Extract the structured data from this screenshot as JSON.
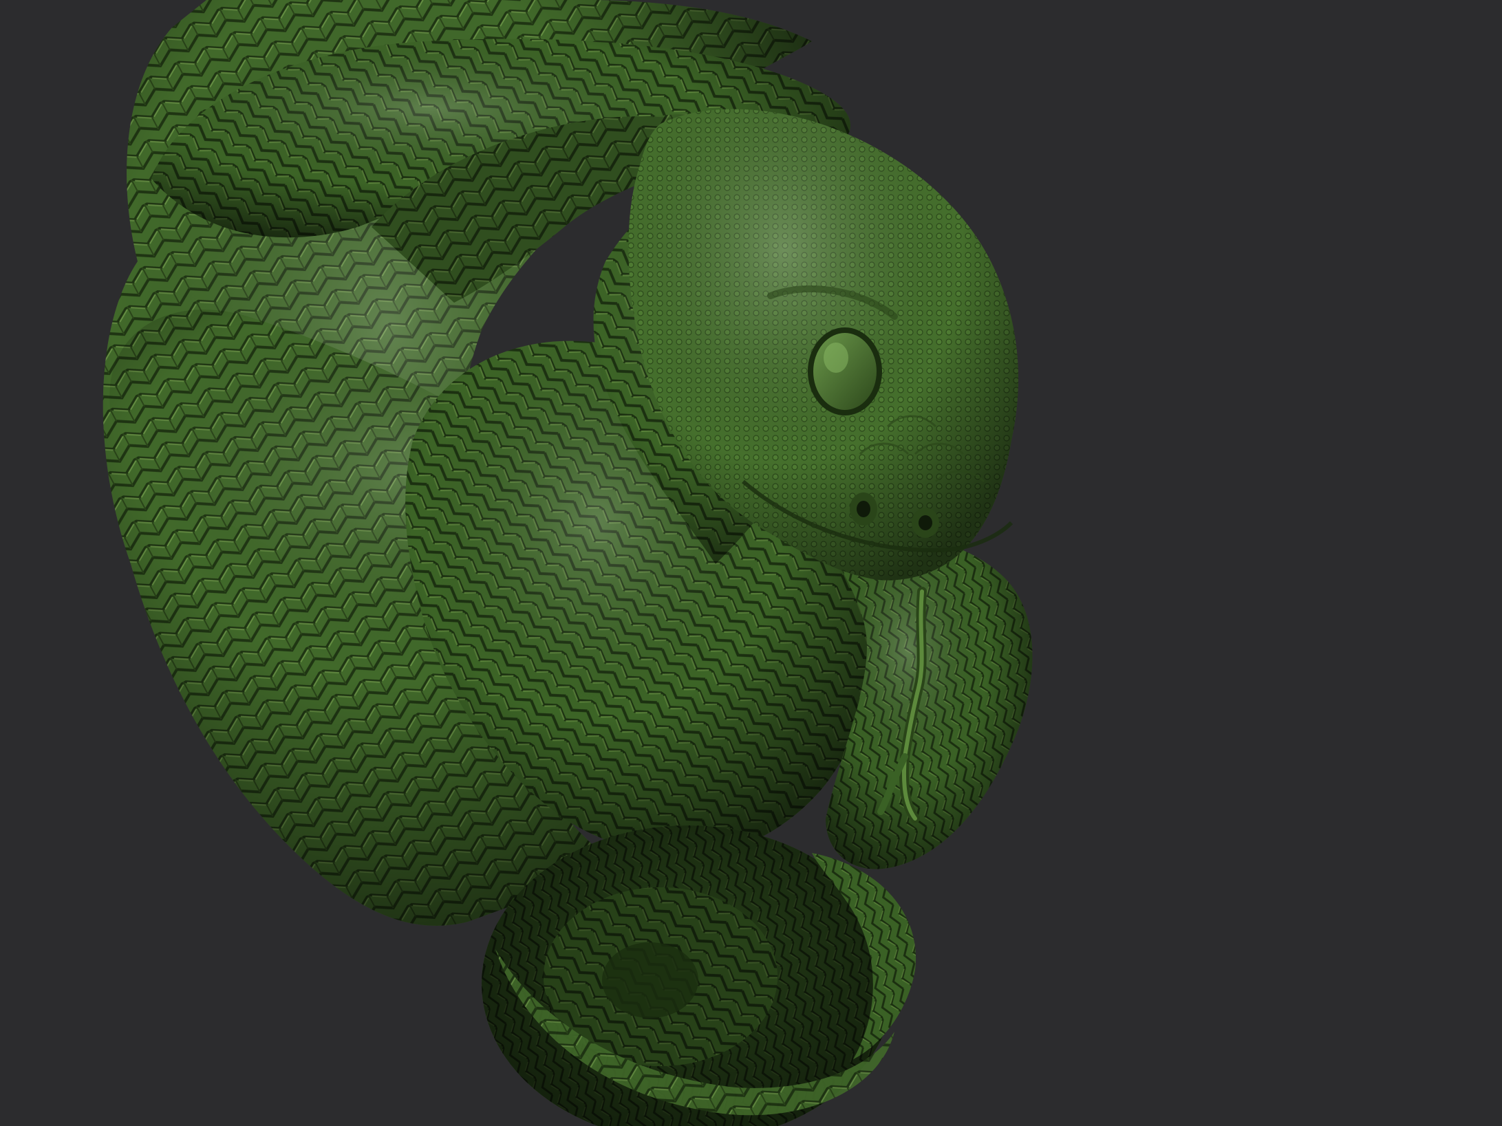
{
  "viewport": {
    "background_color": "#2c2c2e"
  },
  "subject": {
    "kind": "sculpted-coiled-snake",
    "colors": {
      "base": "#3f6a28",
      "shadow": "#1b2e10",
      "deep_shadow": "#0f1a09",
      "highlight": "#7fae5a",
      "scale_edge": "#24401a"
    }
  }
}
